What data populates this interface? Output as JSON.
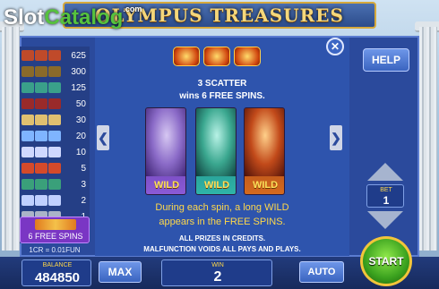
{
  "header": {
    "title": "OLYMPUS TREASURES",
    "logo_slot": "Slot",
    "logo_catalog": "Catalog",
    "logo_com": ".com"
  },
  "paytable": {
    "rows": [
      {
        "value": "625",
        "color": "#c04a2a"
      },
      {
        "value": "300",
        "color": "#8a6a2a"
      },
      {
        "value": "125",
        "color": "#3aa08a"
      },
      {
        "value": "50",
        "color": "#9a2a2a"
      },
      {
        "value": "30",
        "color": "#e0c070"
      },
      {
        "value": "20",
        "color": "#7fb4ff"
      },
      {
        "value": "10",
        "color": "#cfd8ff"
      },
      {
        "value": "5",
        "color": "#d44a2a"
      },
      {
        "value": "3",
        "color": "#3aa07a"
      },
      {
        "value": "2",
        "color": "#c0d0ff"
      },
      {
        "value": "1",
        "color": "#aab4c8"
      }
    ],
    "free_spins_label": "6 FREE SPINS",
    "rate": "1CR = 0.01FUN"
  },
  "info": {
    "scatter_line1": "3 SCATTER",
    "scatter_line2": "wins 6 FREE SPINS.",
    "wild_label": "WILD",
    "wild_line1": "During each spin, a long WILD",
    "wild_line2": "appears in the FREE SPINS.",
    "credits_line": "ALL PRIZES IN CREDITS.",
    "malfunction_line": "MALFUNCTION VOIDS ALL PAYS AND PLAYS."
  },
  "controls": {
    "help_label": "HELP",
    "close_glyph": "✕",
    "prev_glyph": "❮",
    "next_glyph": "❯",
    "bet_label": "BET",
    "bet_value": "1",
    "balance_label": "BALANCE",
    "balance_value": "484850",
    "max_label": "MAX",
    "win_label": "WIN",
    "win_value": "2",
    "auto_label": "AUTO",
    "start_label": "START"
  },
  "colors": {
    "panel": "#2b4a9c",
    "accent_gold": "#ffd84a",
    "start_green": "#3aa11e"
  }
}
